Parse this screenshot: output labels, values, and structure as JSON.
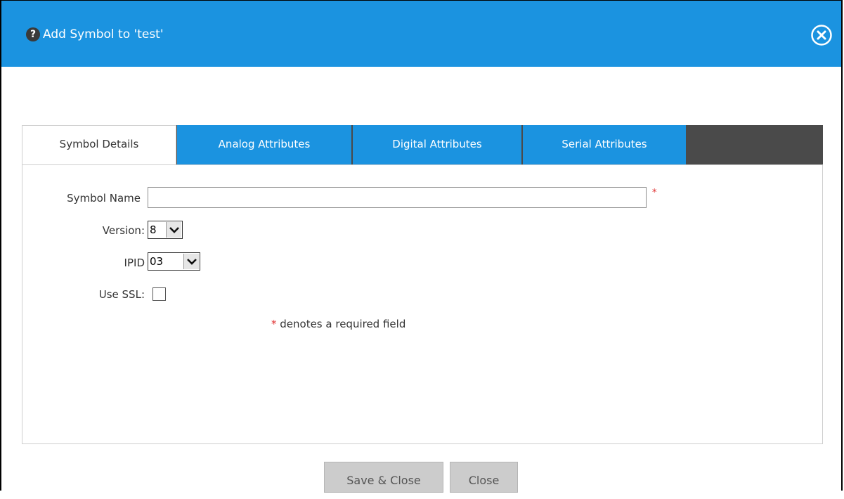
{
  "dialog": {
    "help_icon": "?",
    "title": "Add Symbol to 'test'",
    "close_icon": "close-circle-icon",
    "accent_color": "#1b93e0"
  },
  "tabs": [
    {
      "label": "Symbol Details",
      "active": true
    },
    {
      "label": "Analog Attributes",
      "active": false
    },
    {
      "label": "Digital Attributes",
      "active": false
    },
    {
      "label": "Serial Attributes",
      "active": false
    }
  ],
  "form": {
    "symbol_name": {
      "label": "Symbol Name",
      "value": "",
      "required_mark": "*"
    },
    "version": {
      "label": "Version:",
      "value": "8"
    },
    "ipid": {
      "label": "IPID",
      "value": "03"
    },
    "use_ssl": {
      "label": "Use SSL:",
      "checked": false
    },
    "required_note": {
      "star": "*",
      "text": " denotes a required field"
    }
  },
  "buttons": {
    "save_close": "Save & Close",
    "close": "Close"
  }
}
